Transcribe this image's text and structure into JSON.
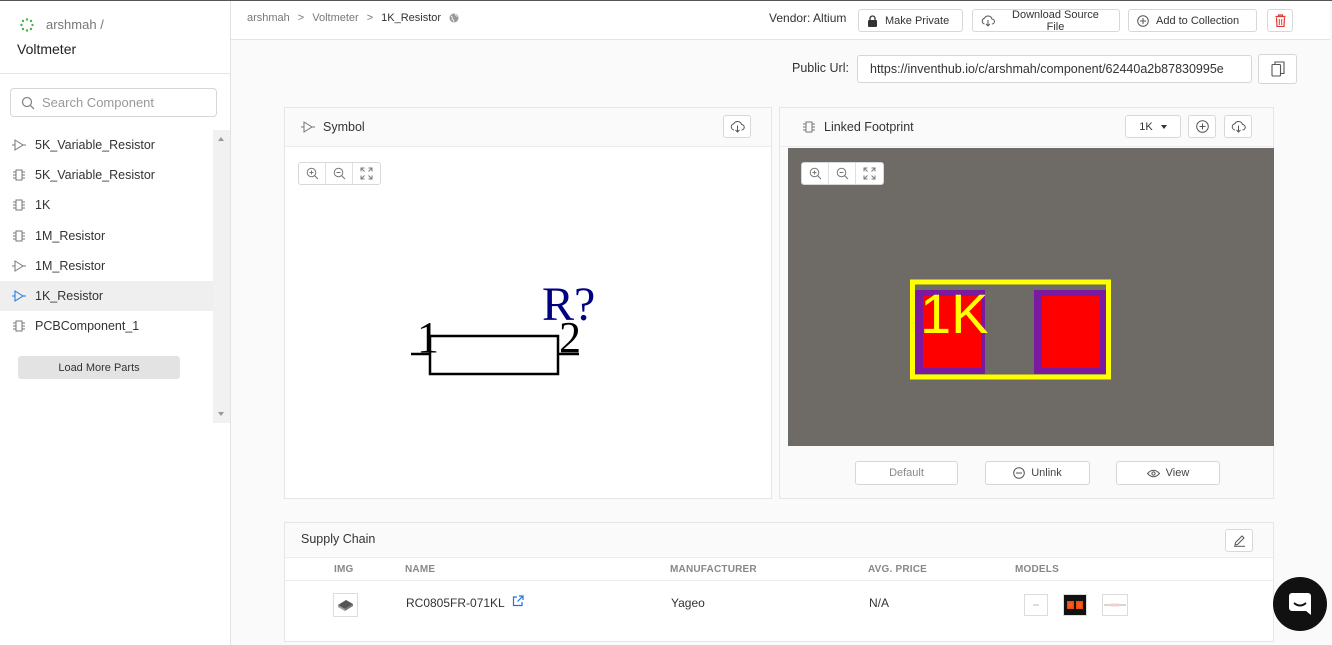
{
  "sidebar": {
    "owner": "arshmah /",
    "project": "Voltmeter",
    "search_placeholder": "Search Component",
    "items": [
      {
        "label": "5K_Variable_Resistor",
        "icon": "symbol-icon"
      },
      {
        "label": "5K_Variable_Resistor",
        "icon": "footprint-icon"
      },
      {
        "label": "1K",
        "icon": "footprint-icon"
      },
      {
        "label": "1M_Resistor",
        "icon": "footprint-icon"
      },
      {
        "label": "1M_Resistor",
        "icon": "symbol-icon"
      },
      {
        "label": "1K_Resistor",
        "icon": "symbol-icon",
        "active": true
      },
      {
        "label": "PCBComponent_1",
        "icon": "footprint-icon"
      }
    ],
    "load_more": "Load More Parts"
  },
  "breadcrumb": {
    "owner": "arshmah",
    "sep1": ">",
    "project": "Voltmeter",
    "sep2": ">",
    "component": "1K_Resistor"
  },
  "toolbar": {
    "vendor": "Vendor: Altium",
    "make_private": "Make Private",
    "download_source": "Download Source File",
    "add_collection": "Add to Collection"
  },
  "public_url": {
    "label": "Public Url:",
    "value": "https://inventhub.io/c/arshmah/component/62440a2b87830995e"
  },
  "symbol_panel": {
    "title": "Symbol",
    "designator": "R?",
    "pin1": "1",
    "pin2": "2"
  },
  "footprint_panel": {
    "title": "Linked Footprint",
    "selected": "1K",
    "label": "1K",
    "default_label": "Default",
    "unlink_label": "Unlink",
    "view_label": "View"
  },
  "supply_chain": {
    "title": "Supply Chain",
    "columns": [
      "IMG",
      "NAME",
      "MANUFACTURER",
      "AVG. PRICE",
      "MODELS"
    ],
    "rows": [
      {
        "name": "RC0805FR-071KL",
        "manufacturer": "Yageo",
        "price": "N/A"
      }
    ]
  },
  "colors": {
    "accent": "#1a73e8",
    "danger": "#e53935",
    "footprint_bg": "#6e6a66",
    "silkscreen": "#ffff00",
    "pad": "#ff0000"
  }
}
